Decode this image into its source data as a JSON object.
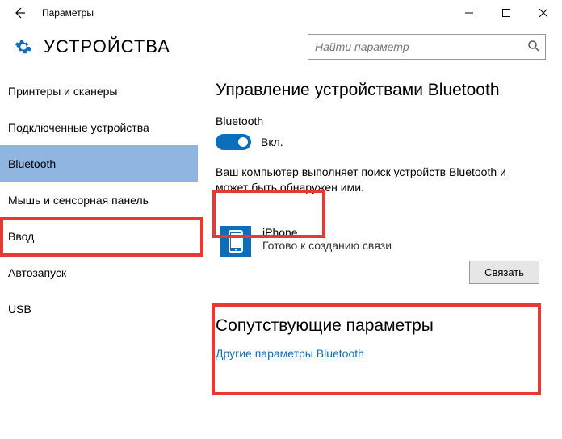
{
  "titlebar": {
    "title": "Параметры"
  },
  "header": {
    "page_title": "УСТРОЙСТВА"
  },
  "search": {
    "placeholder": "Найти параметр"
  },
  "sidebar": {
    "items": [
      {
        "label": "Принтеры и сканеры"
      },
      {
        "label": "Подключенные устройства"
      },
      {
        "label": "Bluetooth"
      },
      {
        "label": "Мышь и сенсорная панель"
      },
      {
        "label": "Ввод"
      },
      {
        "label": "Автозапуск"
      },
      {
        "label": "USB"
      }
    ],
    "selected_index": 2
  },
  "content": {
    "heading": "Управление устройствами Bluetooth",
    "bt_label": "Bluetooth",
    "toggle_state": "Вкл.",
    "desc": "Ваш компьютер выполняет поиск устройств Bluetooth и может быть обнаружен ими.",
    "device": {
      "name": "iPhone",
      "status": "Готово к созданию связи"
    },
    "pair_button": "Связать",
    "related_heading": "Сопутствующие параметры",
    "link": "Другие параметры Bluetooth"
  }
}
